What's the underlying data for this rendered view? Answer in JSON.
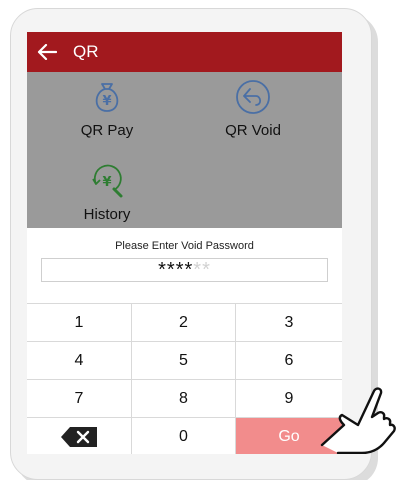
{
  "appbar": {
    "title": "QR"
  },
  "menu": {
    "qr_pay": "QR Pay",
    "qr_void": "QR Void",
    "history": "History"
  },
  "dialog": {
    "prompt": "Please Enter Void Password",
    "password_filled": "****",
    "password_empty": "**"
  },
  "keypad": {
    "rows": [
      [
        "1",
        "2",
        "3"
      ],
      [
        "4",
        "5",
        "6"
      ],
      [
        "7",
        "8",
        "9"
      ],
      [
        "",
        "0",
        "Go"
      ]
    ],
    "delete_icon": "backspace-icon"
  },
  "colors": {
    "appbar": "#a2191e",
    "overlay": "#9a9a9a",
    "go_button": "#f28c8c",
    "icon_blue": "#4a6fa5",
    "icon_green": "#2e7d32"
  }
}
